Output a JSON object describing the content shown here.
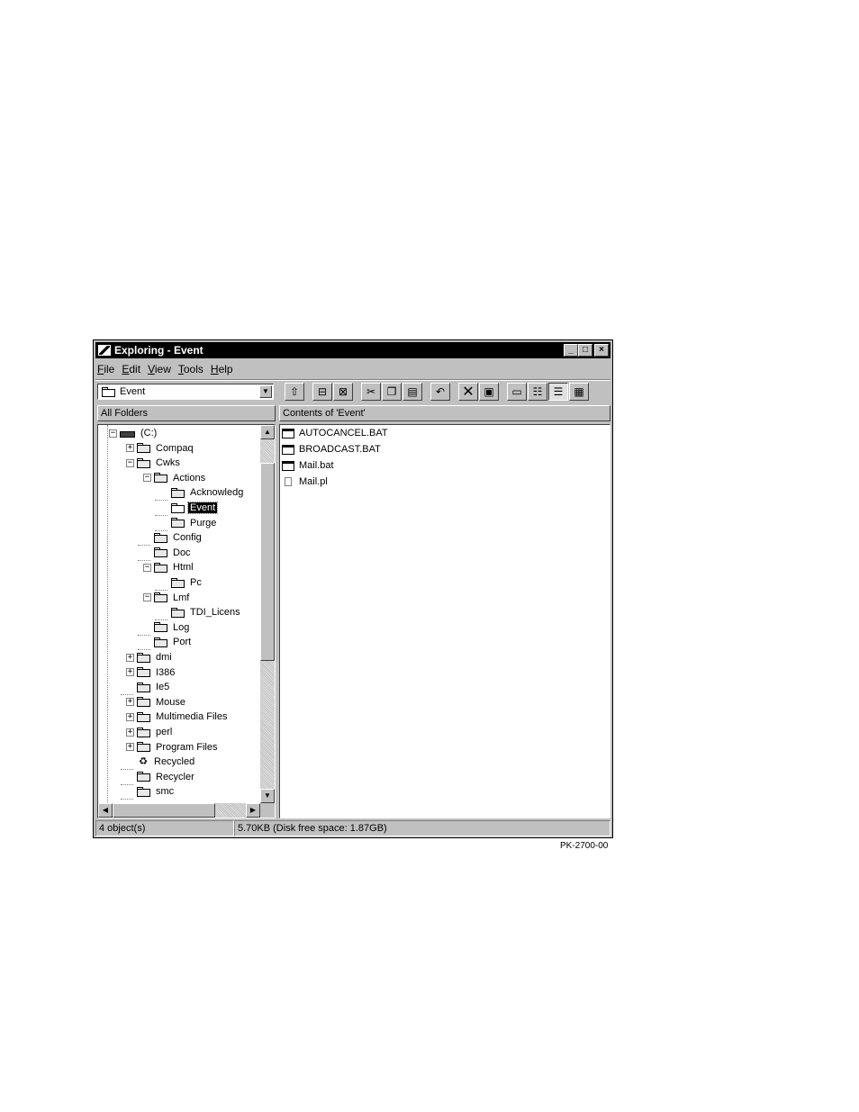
{
  "window": {
    "title": "Exploring - Event",
    "minimize": "_",
    "maximize": "□",
    "close": "×"
  },
  "menu": [
    "File",
    "Edit",
    "View",
    "Tools",
    "Help"
  ],
  "address": {
    "value": "Event"
  },
  "toolbar": {
    "buttons": [
      "up-folder",
      "map-drive",
      "disconnect-drive",
      "cut",
      "copy",
      "paste",
      "undo",
      "delete",
      "properties",
      "large-icons",
      "small-icons",
      "list",
      "details"
    ]
  },
  "panes": {
    "left_header": "All Folders",
    "right_header": "Contents of 'Event'"
  },
  "tree": [
    {
      "label": "(C:)",
      "level": 0,
      "type": "drive",
      "expander": "−"
    },
    {
      "label": "Compaq",
      "level": 1,
      "type": "folder",
      "expander": "+"
    },
    {
      "label": "Cwks",
      "level": 1,
      "type": "folder",
      "expander": "−"
    },
    {
      "label": "Actions",
      "level": 2,
      "type": "folder",
      "expander": "−"
    },
    {
      "label": "Acknowledg",
      "level": 3,
      "type": "folder",
      "expander": ""
    },
    {
      "label": "Event",
      "level": 3,
      "type": "folder-open",
      "expander": "",
      "selected": true
    },
    {
      "label": "Purge",
      "level": 3,
      "type": "folder",
      "expander": ""
    },
    {
      "label": "Config",
      "level": 2,
      "type": "folder",
      "expander": ""
    },
    {
      "label": "Doc",
      "level": 2,
      "type": "folder",
      "expander": ""
    },
    {
      "label": "Html",
      "level": 2,
      "type": "folder",
      "expander": "−"
    },
    {
      "label": "Pc",
      "level": 3,
      "type": "folder",
      "expander": ""
    },
    {
      "label": "Lmf",
      "level": 2,
      "type": "folder",
      "expander": "−"
    },
    {
      "label": "TDI_Licens",
      "level": 3,
      "type": "folder",
      "expander": ""
    },
    {
      "label": "Log",
      "level": 2,
      "type": "folder",
      "expander": ""
    },
    {
      "label": "Port",
      "level": 2,
      "type": "folder",
      "expander": ""
    },
    {
      "label": "dmi",
      "level": 1,
      "type": "folder",
      "expander": "+"
    },
    {
      "label": "I386",
      "level": 1,
      "type": "folder",
      "expander": "+"
    },
    {
      "label": "Ie5",
      "level": 1,
      "type": "folder",
      "expander": ""
    },
    {
      "label": "Mouse",
      "level": 1,
      "type": "folder",
      "expander": "+"
    },
    {
      "label": "Multimedia Files",
      "level": 1,
      "type": "folder",
      "expander": "+"
    },
    {
      "label": "perl",
      "level": 1,
      "type": "folder",
      "expander": "+"
    },
    {
      "label": "Program Files",
      "level": 1,
      "type": "folder",
      "expander": "+"
    },
    {
      "label": "Recycled",
      "level": 1,
      "type": "recycle",
      "expander": ""
    },
    {
      "label": "Recycler",
      "level": 1,
      "type": "folder",
      "expander": ""
    },
    {
      "label": "smc",
      "level": 1,
      "type": "folder",
      "expander": ""
    }
  ],
  "files": [
    {
      "name": "AUTOCANCEL.BAT",
      "icon": "batch-file-icon"
    },
    {
      "name": "BROADCAST.BAT",
      "icon": "batch-file-icon"
    },
    {
      "name": "Mail.bat",
      "icon": "batch-file-icon"
    },
    {
      "name": "Mail.pl",
      "icon": "document-icon"
    }
  ],
  "status": {
    "objects": "4 object(s)",
    "size": "5.70KB (Disk free space: 1.87GB)"
  },
  "figure_id": "PK-2700-00"
}
